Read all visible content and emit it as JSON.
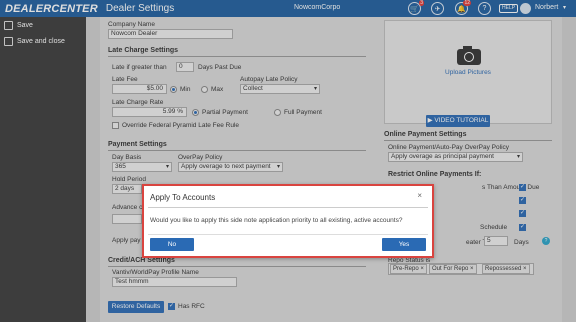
{
  "header": {
    "brand": "DEALERCENTER",
    "page_title": "Dealer Settings",
    "dealer_name": "NowcomCorpo",
    "badges": {
      "cart": "3",
      "alerts": "12"
    },
    "help": "HELP",
    "user": "Norbert"
  },
  "sidebar": {
    "items": [
      {
        "label": "Save",
        "icon": "save-icon"
      },
      {
        "label": "Save and close",
        "icon": "save-close-icon"
      }
    ]
  },
  "form": {
    "company_name_label": "Company Name",
    "company_name_value": "Nowcom Dealer",
    "late_charge_header": "Late Charge Settings",
    "late_if_label": "Late if greater than",
    "late_days_value": "0",
    "days_past_due": "Days Past Due",
    "late_fee_label": "Late Fee",
    "late_fee_value": "$5.00",
    "min_label": "Min",
    "max_label": "Max",
    "autopay_policy_label": "Autopay Late Policy",
    "autopay_policy_value": "Collect",
    "late_charge_rate_label": "Late Charge Rate",
    "late_charge_rate_value": "5.99 %",
    "partial_payment": "Partial Payment",
    "full_payment": "Full Payment",
    "override_label": "Override Federal Pyramid Late Fee Rule",
    "payment_settings_header": "Payment Settings",
    "day_basis_label": "Day Basis",
    "day_basis_value": "365",
    "overpay_policy_label": "OverPay Policy",
    "overpay_policy_value": "Apply overage to next payment",
    "hold_period_label": "Hold Period",
    "hold_period_value": "2 days",
    "advance_label": "Advance c",
    "apply_pay_label": "Apply pay",
    "credit_ach_header": "Credit/ACH Settings",
    "vantiv_label": "Vantiv/WorldPay Profile Name",
    "vantiv_value": "Test hmmm",
    "restore_defaults": "Restore Defaults",
    "has_rfc": "Has RFC"
  },
  "right": {
    "upload_pictures": "Upload Pictures",
    "video_tutorial": "VIDEO TUTORIAL",
    "online_payment_header": "Online Payment Settings",
    "autopay_overpay_label": "Online Payment/Auto-Pay OverPay Policy",
    "autopay_overpay_value": "Apply overage as principal payment",
    "restrict_header": "Restrict Online Payments If:",
    "than_amount_due": "s Than Amount Due",
    "schedule": "Schedule",
    "greater_than": "eater Than",
    "greater_value": "5",
    "days": "Days",
    "repo_status_label": "Repo Status is",
    "repo_tags": [
      "Pre-Repo",
      "Out For Repo",
      "Repossessed"
    ]
  },
  "modal": {
    "title": "Apply To Accounts",
    "close": "×",
    "message": "Would you like to apply this side note application priority to all existing, active accounts?",
    "no_label": "No",
    "yes_label": "Yes"
  }
}
